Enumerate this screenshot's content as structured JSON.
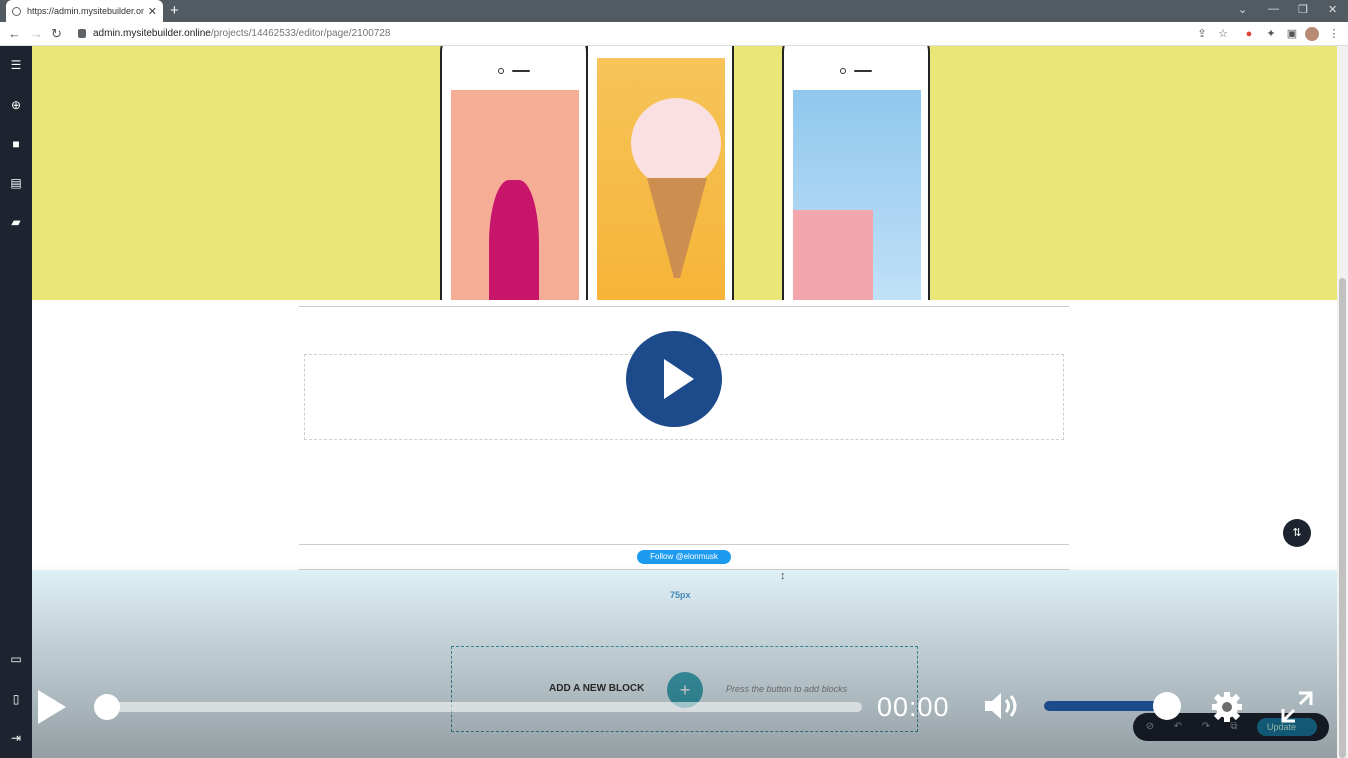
{
  "browser": {
    "tab_title": "https://admin.mysitebuilder.online",
    "tab_close": "✕",
    "new_tab": "+",
    "url_host": "admin.mysitebuilder.online",
    "url_path": "/projects/14462533/editor/page/2100728"
  },
  "editor": {
    "follow_button": "Follow @elonmusk",
    "spacing_label": "75px",
    "add_block_label": "ADD A NEW BLOCK",
    "add_block_plus": "+",
    "add_block_hint": "Press the button to add blocks",
    "update_label": "Update"
  },
  "player": {
    "time": "00:00",
    "progress": 0,
    "volume": 1
  },
  "colors": {
    "hero_bg": "#eae678",
    "play_button": "#1c4a8a",
    "sidebar": "#1d2430"
  }
}
